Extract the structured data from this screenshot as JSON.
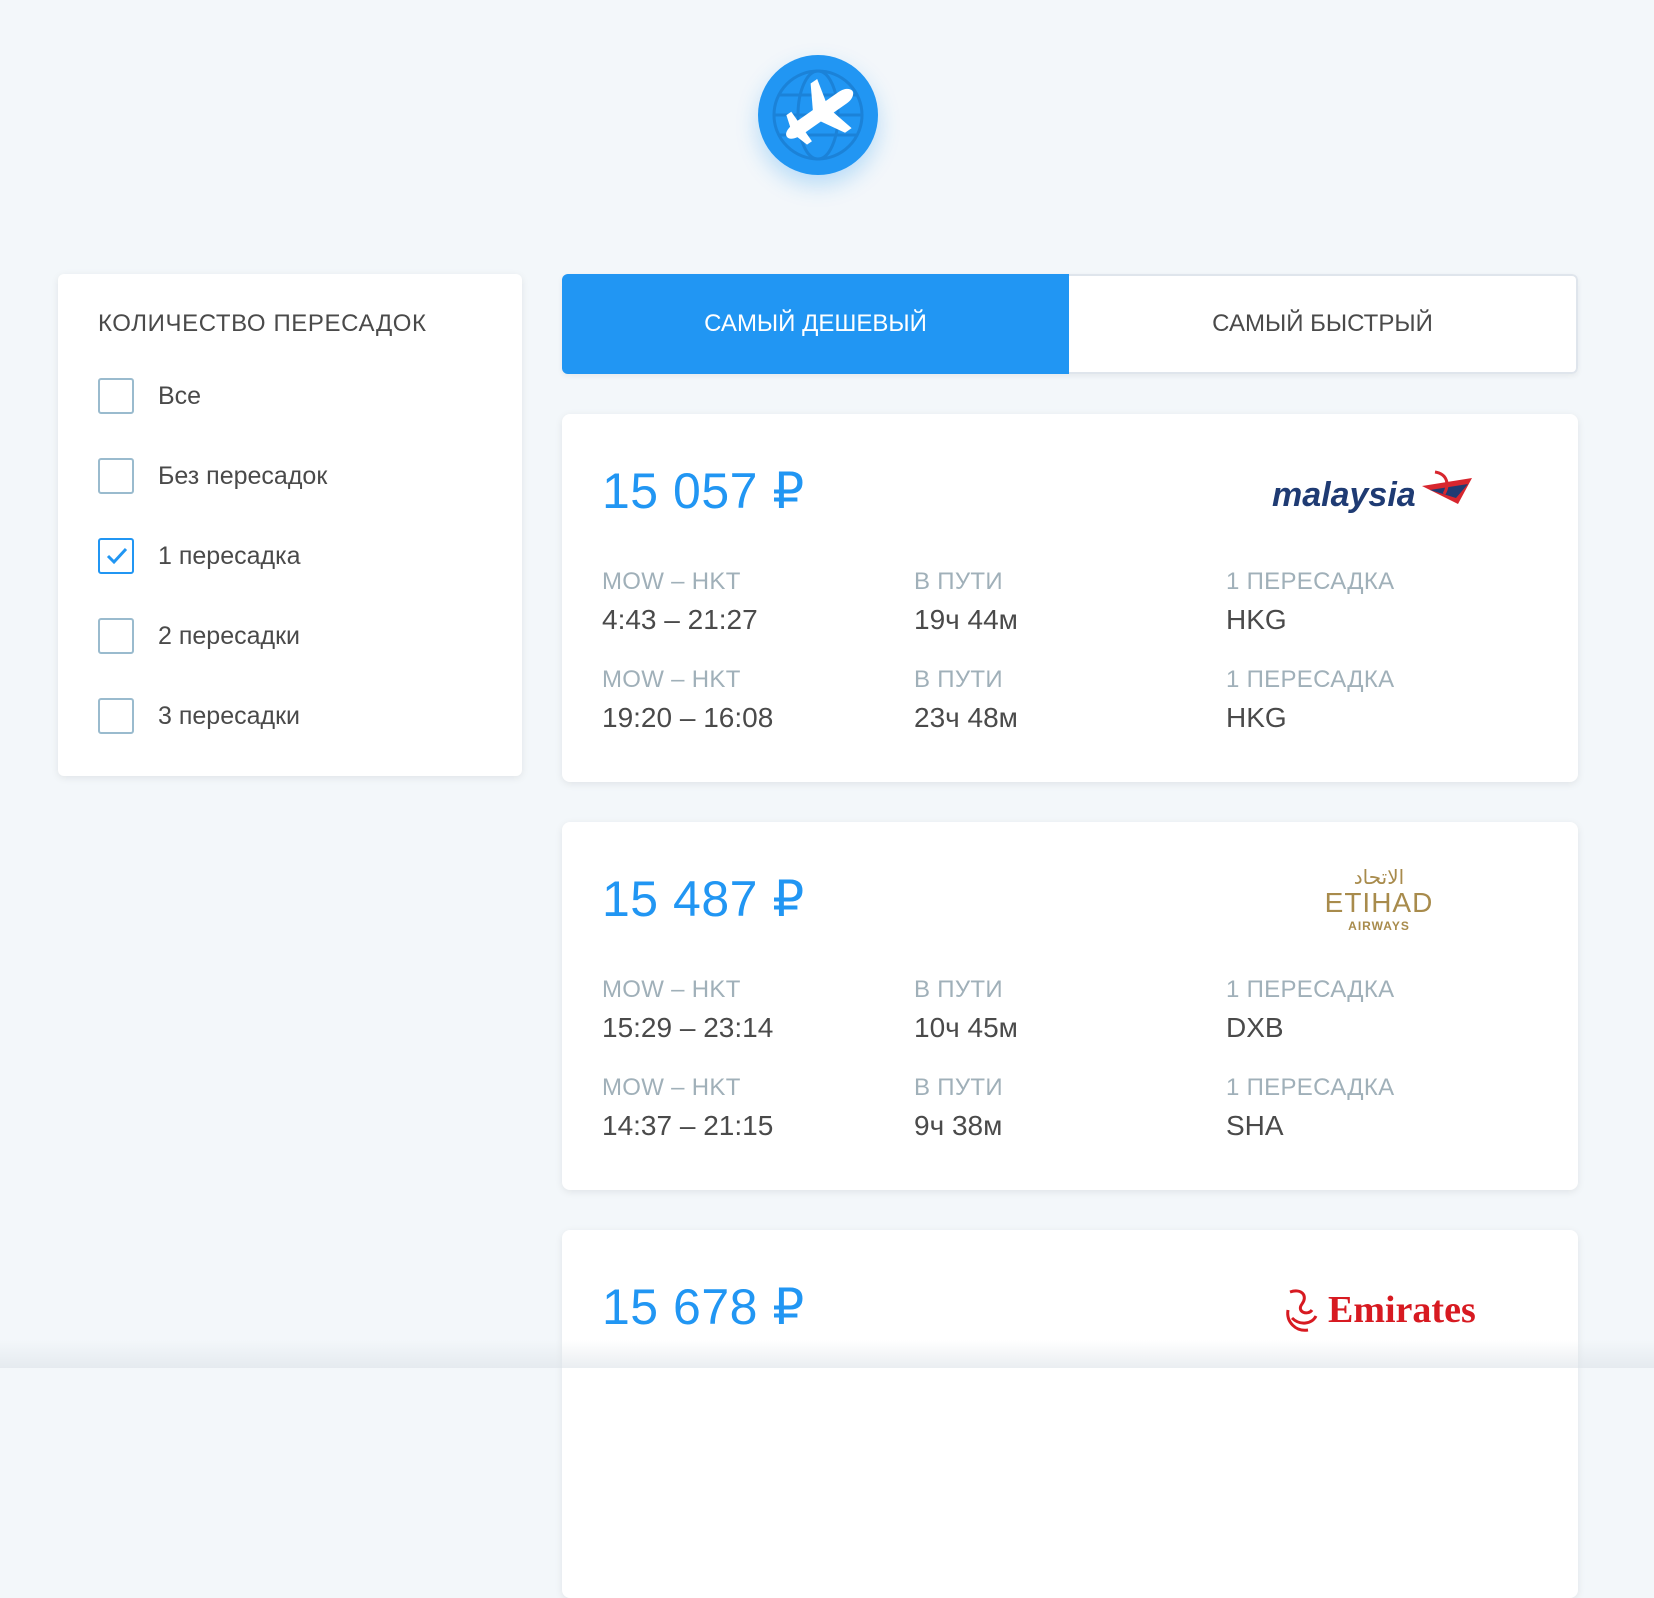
{
  "filter": {
    "title": "КОЛИЧЕСТВО ПЕРЕСАДОК",
    "options": [
      {
        "label": "Все",
        "checked": false
      },
      {
        "label": "Без пересадок",
        "checked": false
      },
      {
        "label": "1 пересадка",
        "checked": true
      },
      {
        "label": "2 пересадки",
        "checked": false
      },
      {
        "label": "3 пересадки",
        "checked": false
      }
    ]
  },
  "tabs": {
    "cheapest": "САМЫЙ ДЕШЕВЫЙ",
    "fastest": "САМЫЙ БЫСТРЫЙ",
    "active": "cheapest"
  },
  "tickets": [
    {
      "price": "15 057 ₽",
      "airline": "malaysia",
      "segments": [
        {
          "route": "MOW – HKT",
          "time": "4:43 – 21:27",
          "duration_label": "В ПУТИ",
          "duration": "19ч 44м",
          "stops_label": "1 ПЕРЕСАДКА",
          "stops": "HKG"
        },
        {
          "route": "MOW – HKT",
          "time": "19:20 – 16:08",
          "duration_label": "В ПУТИ",
          "duration": "23ч 48м",
          "stops_label": "1 ПЕРЕСАДКА",
          "stops": "HKG"
        }
      ]
    },
    {
      "price": "15 487 ₽",
      "airline": "ETIHAD",
      "airline_sub": "AIRWAYS",
      "airline_ar": "الاتحاد",
      "segments": [
        {
          "route": "MOW – HKT",
          "time": "15:29 – 23:14",
          "duration_label": "В ПУТИ",
          "duration": "10ч 45м",
          "stops_label": "1 ПЕРЕСАДКА",
          "stops": "DXB"
        },
        {
          "route": "MOW – HKT",
          "time": "14:37 – 21:15",
          "duration_label": "В ПУТИ",
          "duration": "9ч 38м",
          "stops_label": "1 ПЕРЕСАДКА",
          "stops": "SHA"
        }
      ]
    },
    {
      "price": "15 678 ₽",
      "airline": "Emirates",
      "segments": []
    }
  ],
  "colors": {
    "accent": "#2196f3",
    "background": "#f3f7fa",
    "muted": "#a0b0b9",
    "text": "#4a4a4a",
    "malaysia_blue": "#1f3b73",
    "malaysia_red": "#d7262e",
    "etihad_gold": "#a88b4c",
    "emirates_red": "#d71a21"
  }
}
